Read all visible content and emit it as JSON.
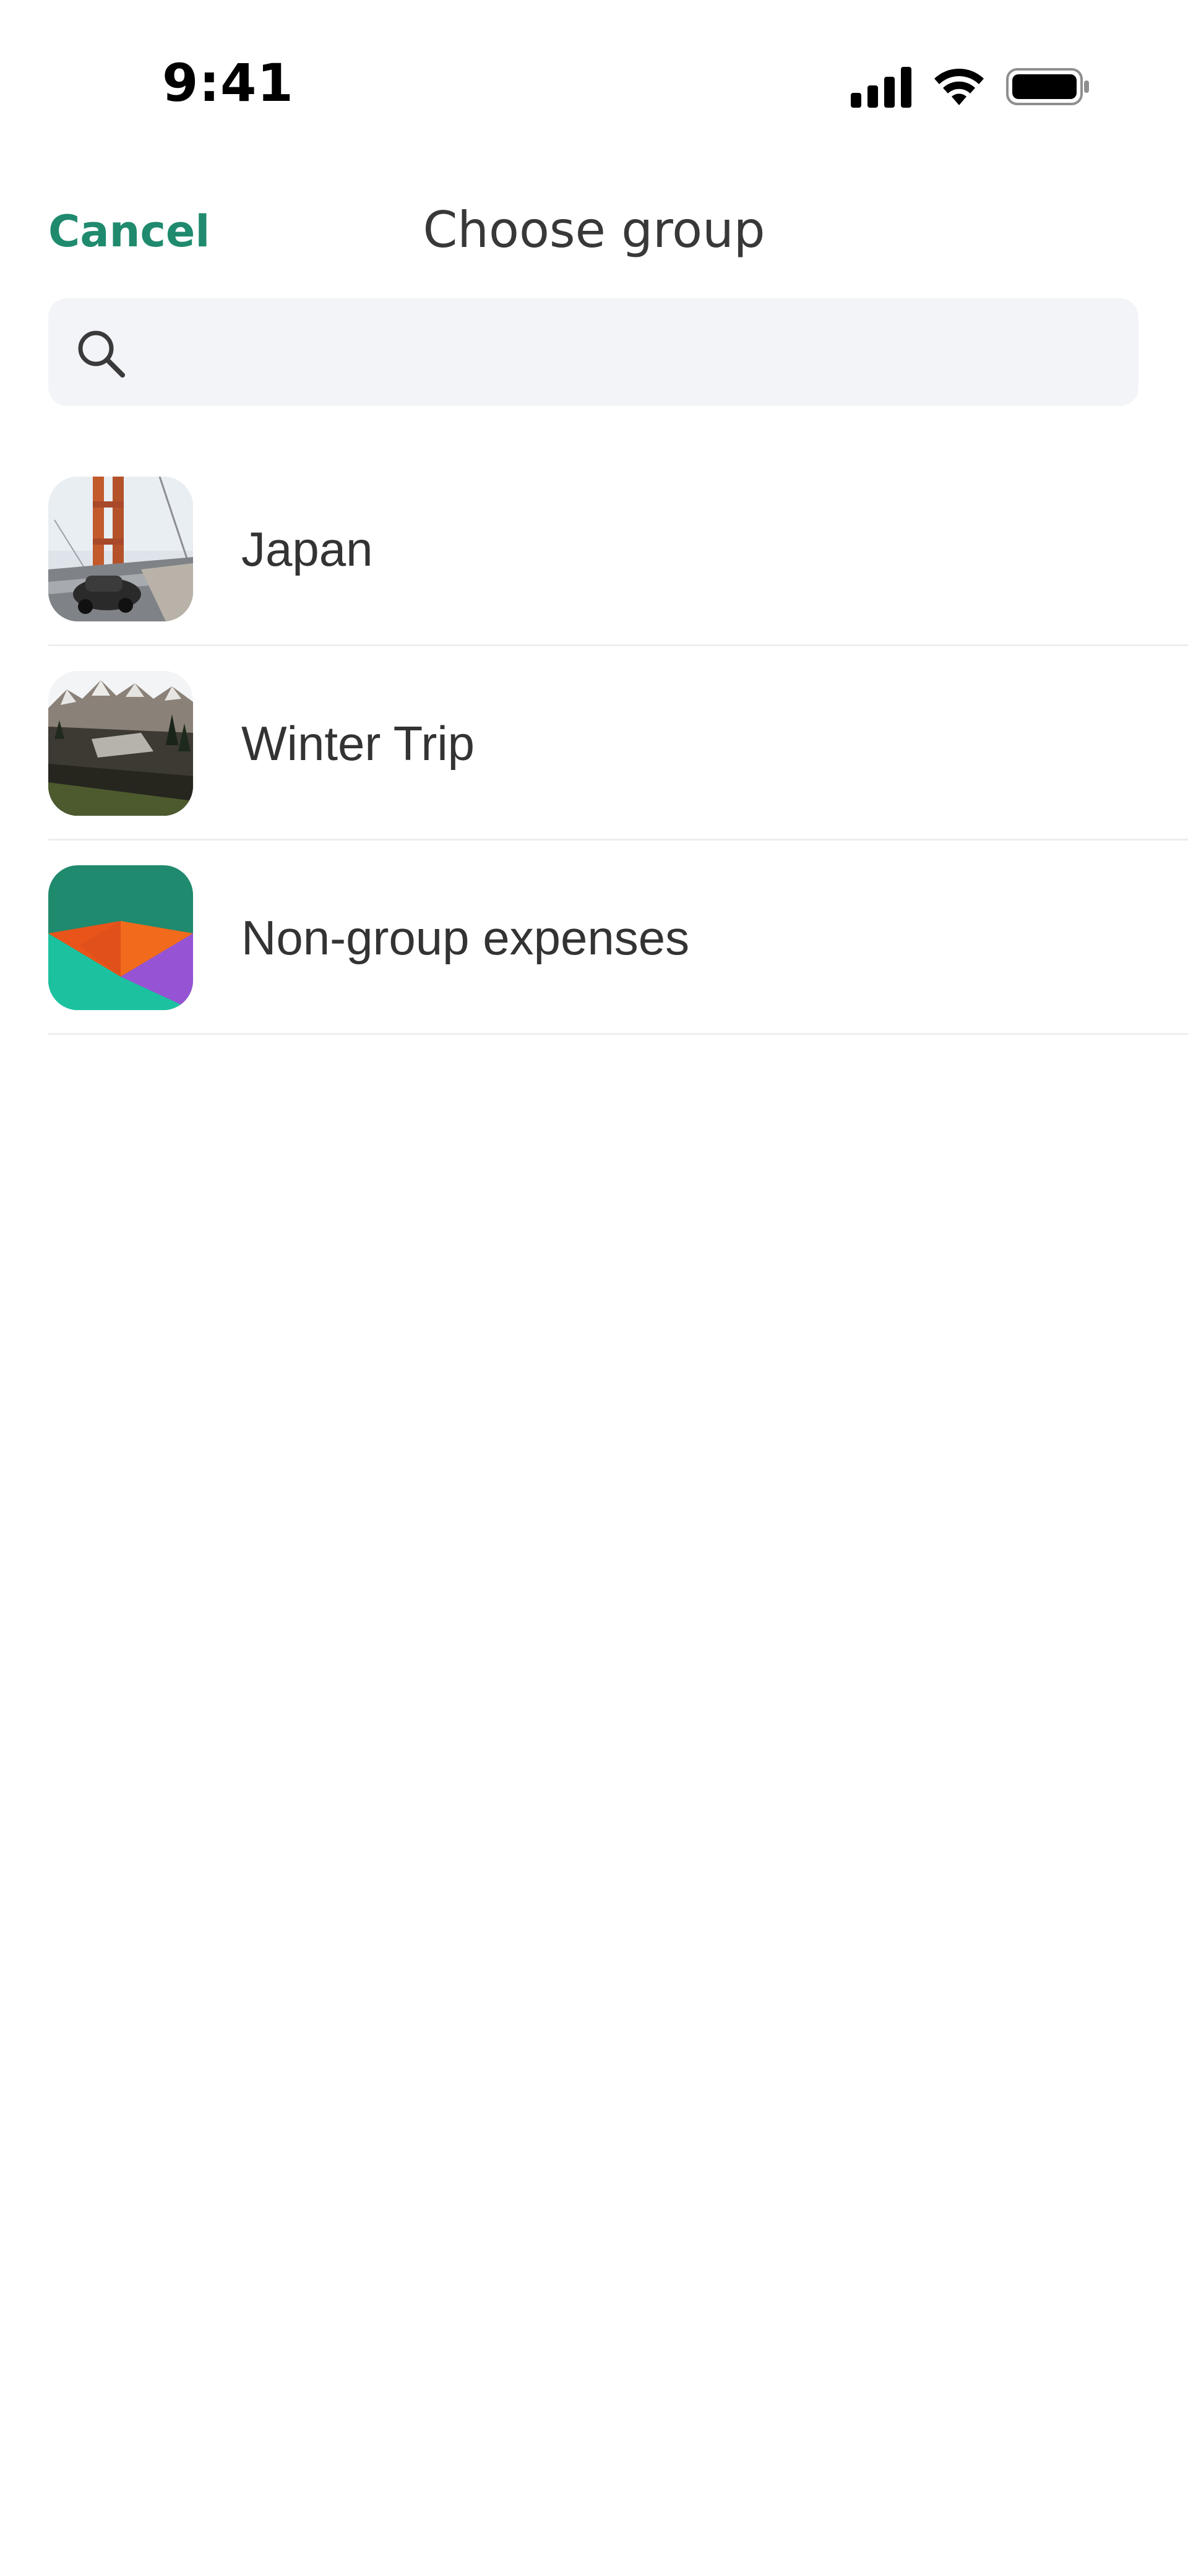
{
  "status_bar": {
    "time": "9:41",
    "icons": [
      "signal-icon",
      "wifi-icon",
      "battery-icon"
    ]
  },
  "header": {
    "cancel_label": "Cancel",
    "title": "Choose group"
  },
  "search": {
    "placeholder": "",
    "value": "",
    "icon": "search-icon"
  },
  "groups": [
    {
      "label": "Japan",
      "thumbnail": "bridge-photo"
    },
    {
      "label": "Winter Trip",
      "thumbnail": "mountain-photo"
    },
    {
      "label": "Non-group expenses",
      "thumbnail": "non-group-logo"
    }
  ],
  "colors": {
    "accent": "#1f8a6e",
    "search_bg": "#f3f4f7",
    "divider": "#eeeeee",
    "text": "#333333"
  }
}
